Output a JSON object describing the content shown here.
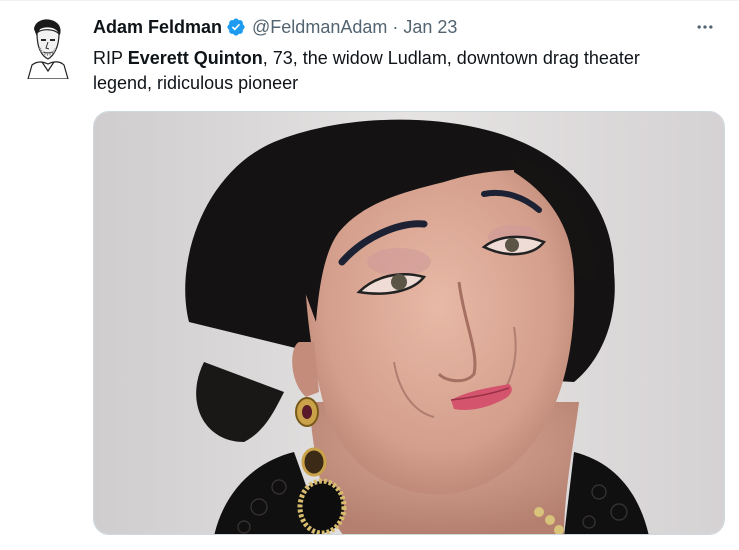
{
  "tweet": {
    "author": {
      "display_name": "Adam Feldman",
      "handle": "@FeldmanAdam",
      "verified": true,
      "avatar_icon": "portrait-sketch-avatar"
    },
    "separator": "·",
    "date": "Jan 23",
    "text": {
      "prefix": "RIP ",
      "bold_name": "Everett Quinton",
      "suffix": ", 73, the widow Ludlam, downtown drag theater legend, ridiculous pioneer"
    },
    "media": {
      "icon": "portrait-photo"
    },
    "more_icon": "more-horizontal-icon"
  },
  "colors": {
    "verified_blue": "#1d9bf0",
    "secondary_text": "#536471",
    "primary_text": "#0f1419"
  }
}
